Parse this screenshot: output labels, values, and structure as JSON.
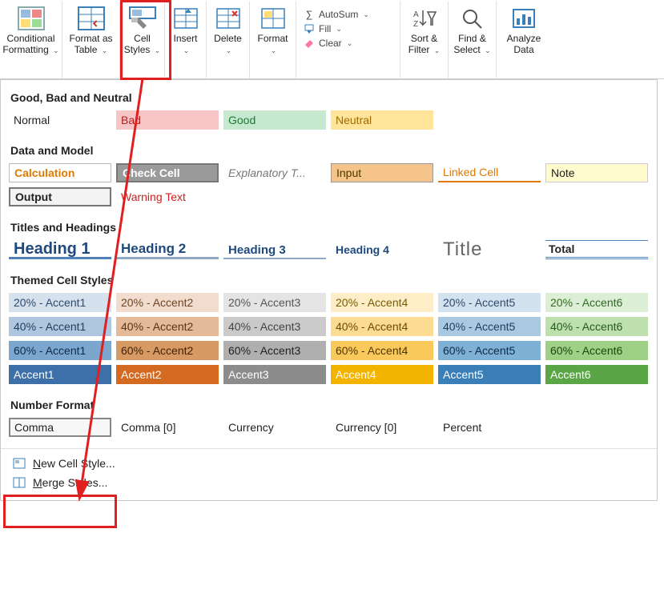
{
  "ribbon": {
    "items": [
      {
        "label": "Conditional\nFormatting ⌄",
        "name": "conditional-formatting-button"
      },
      {
        "label": "Format as\nTable ⌄",
        "name": "format-as-table-button"
      },
      {
        "label": "Cell\nStyles ⌄",
        "name": "cell-styles-button"
      },
      {
        "label": "Insert\n⌄",
        "name": "insert-button"
      },
      {
        "label": "Delete\n⌄",
        "name": "delete-button"
      },
      {
        "label": "Format\n⌄",
        "name": "format-button"
      }
    ],
    "editing": {
      "autosum": "AutoSum",
      "fill": "Fill",
      "clear": "Clear"
    },
    "sortfilter": "Sort &\nFilter ⌄",
    "findselect": "Find &\nSelect ⌄",
    "analyze": "Analyze\nData"
  },
  "sections": {
    "goodbad": {
      "title": "Good, Bad and Neutral",
      "items": [
        "Normal",
        "Bad",
        "Good",
        "Neutral"
      ]
    },
    "datamodel": {
      "title": "Data and Model",
      "items": [
        "Calculation",
        "Check Cell",
        "Explanatory T...",
        "Input",
        "Linked Cell",
        "Note",
        "Output",
        "Warning Text"
      ]
    },
    "titles": {
      "title": "Titles and Headings",
      "items": [
        "Heading 1",
        "Heading 2",
        "Heading 3",
        "Heading 4",
        "Title",
        "Total"
      ]
    },
    "themed": {
      "title": "Themed Cell Styles",
      "rows": [
        [
          "20% - Accent1",
          "20% - Accent2",
          "20% - Accent3",
          "20% - Accent4",
          "20% - Accent5",
          "20% - Accent6"
        ],
        [
          "40% - Accent1",
          "40% - Accent2",
          "40% - Accent3",
          "40% - Accent4",
          "40% - Accent5",
          "40% - Accent6"
        ],
        [
          "60% - Accent1",
          "60% - Accent2",
          "60% - Accent3",
          "60% - Accent4",
          "60% - Accent5",
          "60% - Accent6"
        ],
        [
          "Accent1",
          "Accent2",
          "Accent3",
          "Accent4",
          "Accent5",
          "Accent6"
        ]
      ]
    },
    "numfmt": {
      "title": "Number Format",
      "items": [
        "Comma",
        "Comma [0]",
        "Currency",
        "Currency [0]",
        "Percent"
      ]
    }
  },
  "menu": {
    "new": "New Cell Style...",
    "merge": "Merge Styles..."
  }
}
